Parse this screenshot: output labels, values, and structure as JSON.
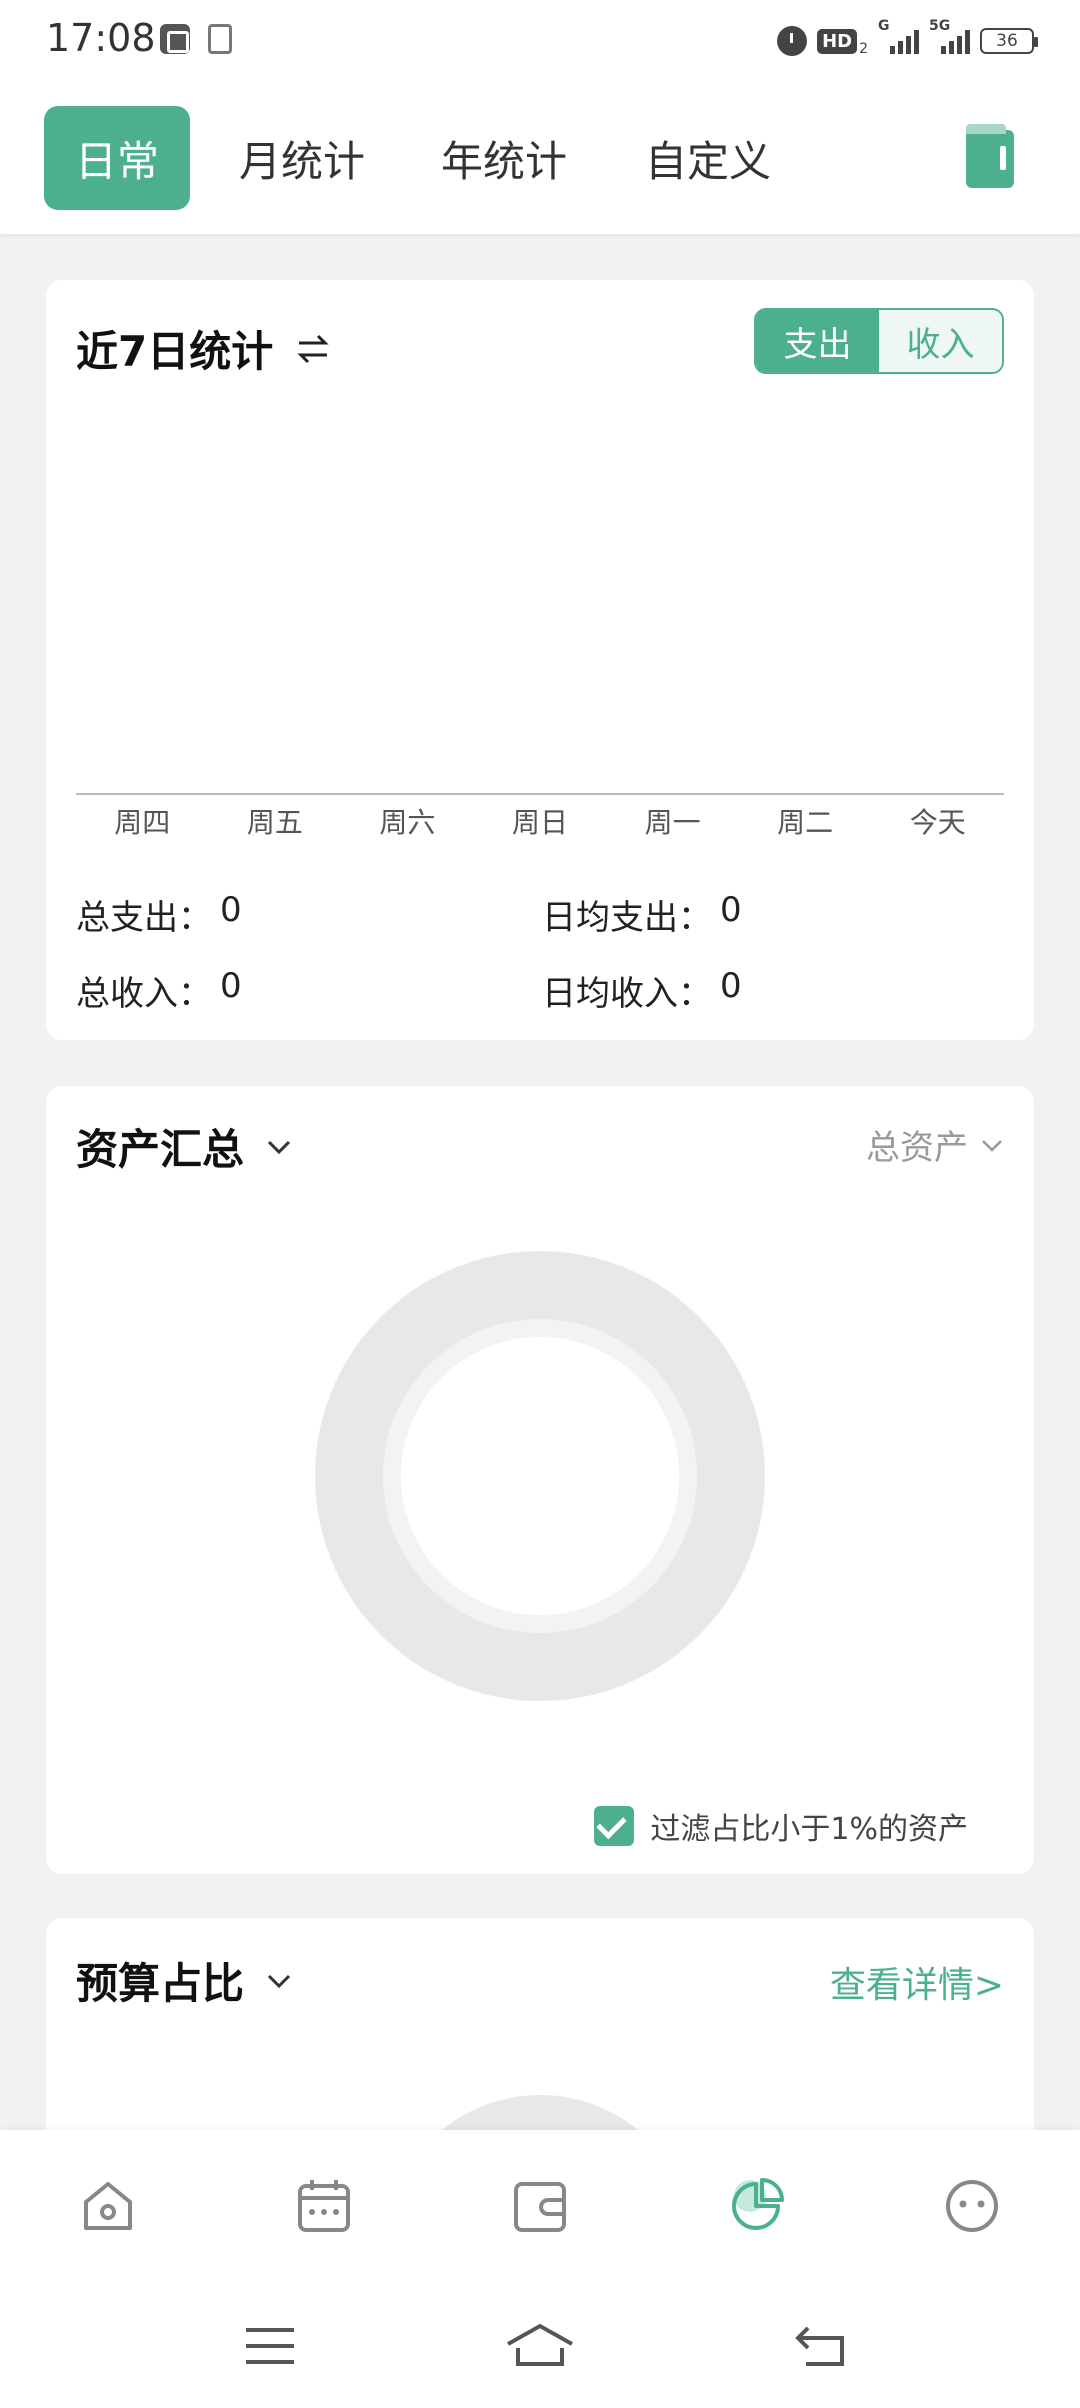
{
  "status_bar": {
    "time": "17:08",
    "hd_label": "HD",
    "hd_sub": "2",
    "signal1_label": "G",
    "signal2_label": "5G",
    "battery": "36"
  },
  "tabs": [
    {
      "label": "日常",
      "active": true
    },
    {
      "label": "月统计",
      "active": false
    },
    {
      "label": "年统计",
      "active": false
    },
    {
      "label": "自定义",
      "active": false
    }
  ],
  "seven_day": {
    "title": "近7日统计",
    "toggle_expense": "支出",
    "toggle_income": "收入",
    "total_expense_label": "总支出：",
    "total_expense_value": "0",
    "daily_expense_label": "日均支出：",
    "daily_expense_value": "0",
    "total_income_label": "总收入：",
    "total_income_value": "0",
    "daily_income_label": "日均收入：",
    "daily_income_value": "0"
  },
  "chart_data": {
    "type": "bar",
    "categories": [
      "周四",
      "周五",
      "周六",
      "周日",
      "周一",
      "周二",
      "今天"
    ],
    "values": [
      0,
      0,
      0,
      0,
      0,
      0,
      0
    ],
    "title": "",
    "xlabel": "",
    "ylabel": "",
    "grid": false
  },
  "asset_summary": {
    "title": "资产汇总",
    "dropdown_value": "总资产",
    "filter_label": "过滤占比小于1%的资产",
    "filter_checked": true
  },
  "budget": {
    "title": "预算占比",
    "link_label": "查看详情>"
  },
  "bottom_nav": [
    {
      "icon": "home-icon",
      "active": false
    },
    {
      "icon": "calendar-icon",
      "active": false
    },
    {
      "icon": "wallet-icon",
      "active": false
    },
    {
      "icon": "pie-chart-icon",
      "active": true
    },
    {
      "icon": "smiley-icon",
      "active": false
    }
  ],
  "colors": {
    "accent": "#4caf8f",
    "accent_light": "#eef7f3",
    "donut_empty": "#e8e8e8",
    "nav_inactive": "#888888"
  }
}
